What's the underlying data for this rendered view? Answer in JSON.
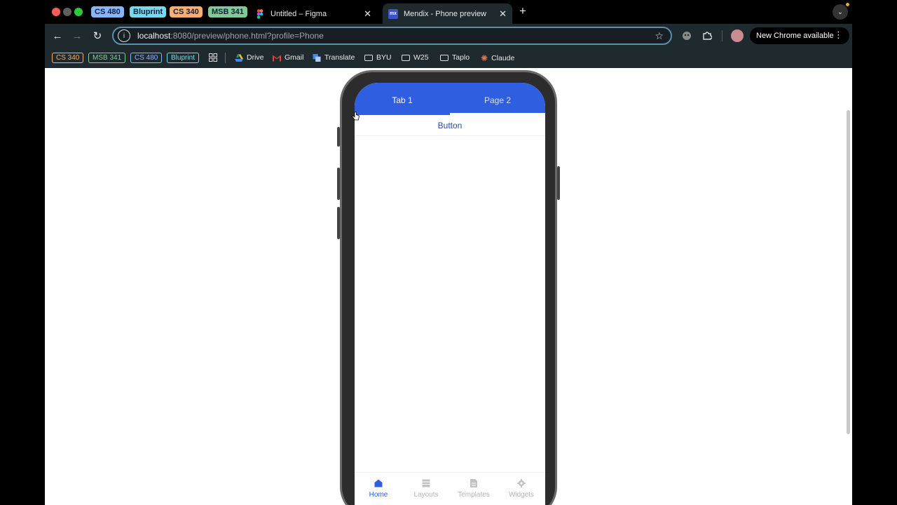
{
  "window": {
    "group_chips": [
      {
        "label": "CS 480",
        "color": "#8ab4f8"
      },
      {
        "label": "Bluprint",
        "color": "#78d9ec"
      },
      {
        "label": "CS 340",
        "color": "#fcad70"
      },
      {
        "label": "MSB 341",
        "color": "#81c995"
      }
    ],
    "tabs": [
      {
        "title": "Untitled – Figma",
        "icon": "figma-icon"
      },
      {
        "title": "Mendix - Phone preview",
        "icon": "mendix-icon",
        "favicon_text": "mx"
      }
    ]
  },
  "toolbar": {
    "url_host": "localhost",
    "url_rest": ":8080/preview/phone.html?profile=Phone",
    "update_label": "New Chrome available"
  },
  "bookmarks": {
    "chips": [
      {
        "label": "CS 340",
        "color": "#fcad70"
      },
      {
        "label": "MSB 341",
        "color": "#81c995"
      },
      {
        "label": "CS 480",
        "color": "#8ab4f8"
      },
      {
        "label": "Bluprint",
        "color": "#78d9ec"
      }
    ],
    "items": [
      {
        "label": "Drive",
        "icon": "google-drive-icon"
      },
      {
        "label": "Gmail",
        "icon": "gmail-icon"
      },
      {
        "label": "Translate",
        "icon": "translate-icon"
      },
      {
        "label": "BYU",
        "icon": "folder-icon"
      },
      {
        "label": "W25",
        "icon": "folder-icon"
      },
      {
        "label": "Taplo",
        "icon": "folder-icon"
      },
      {
        "label": "Claude",
        "icon": "claude-icon"
      }
    ]
  },
  "phone": {
    "tabs": [
      {
        "label": "Tab 1"
      },
      {
        "label": "Page 2"
      }
    ],
    "button_label": "Button",
    "bottom_nav": [
      {
        "label": "Home",
        "icon": "home-icon"
      },
      {
        "label": "Layouts",
        "icon": "layouts-icon"
      },
      {
        "label": "Templates",
        "icon": "templates-icon"
      },
      {
        "label": "Widgets",
        "icon": "widgets-icon"
      }
    ],
    "accent_color": "#2f5ee0"
  }
}
